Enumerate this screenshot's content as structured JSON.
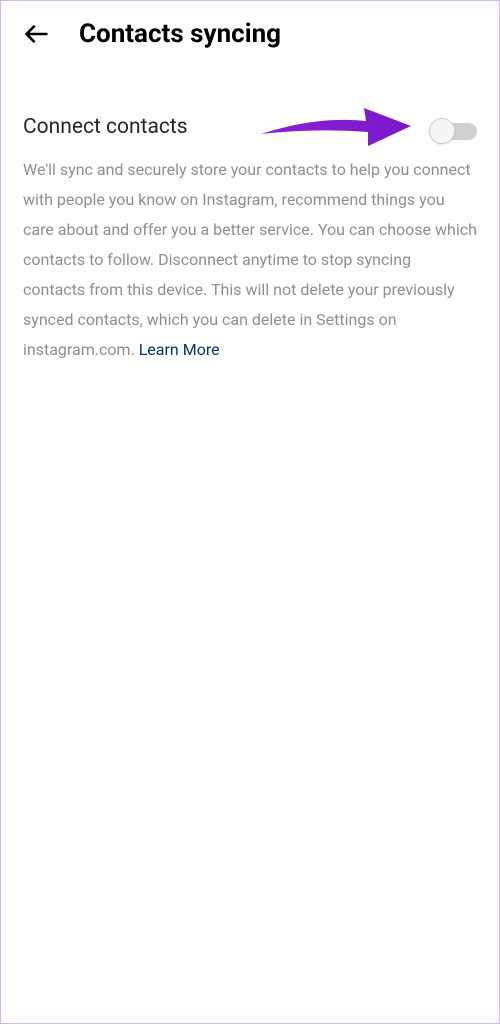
{
  "header": {
    "title": "Contacts syncing"
  },
  "setting": {
    "label": "Connect contacts",
    "toggle_state": "off"
  },
  "description": {
    "text": "We'll sync and securely store your contacts to help you connect with people you know on Instagram, recommend things you care about and offer you a better service. You can choose which contacts to follow. Disconnect anytime to stop syncing contacts from this device. This will not delete your previously synced contacts, which you can delete in Settings on instagram.com. ",
    "learn_more_label": "Learn More"
  }
}
